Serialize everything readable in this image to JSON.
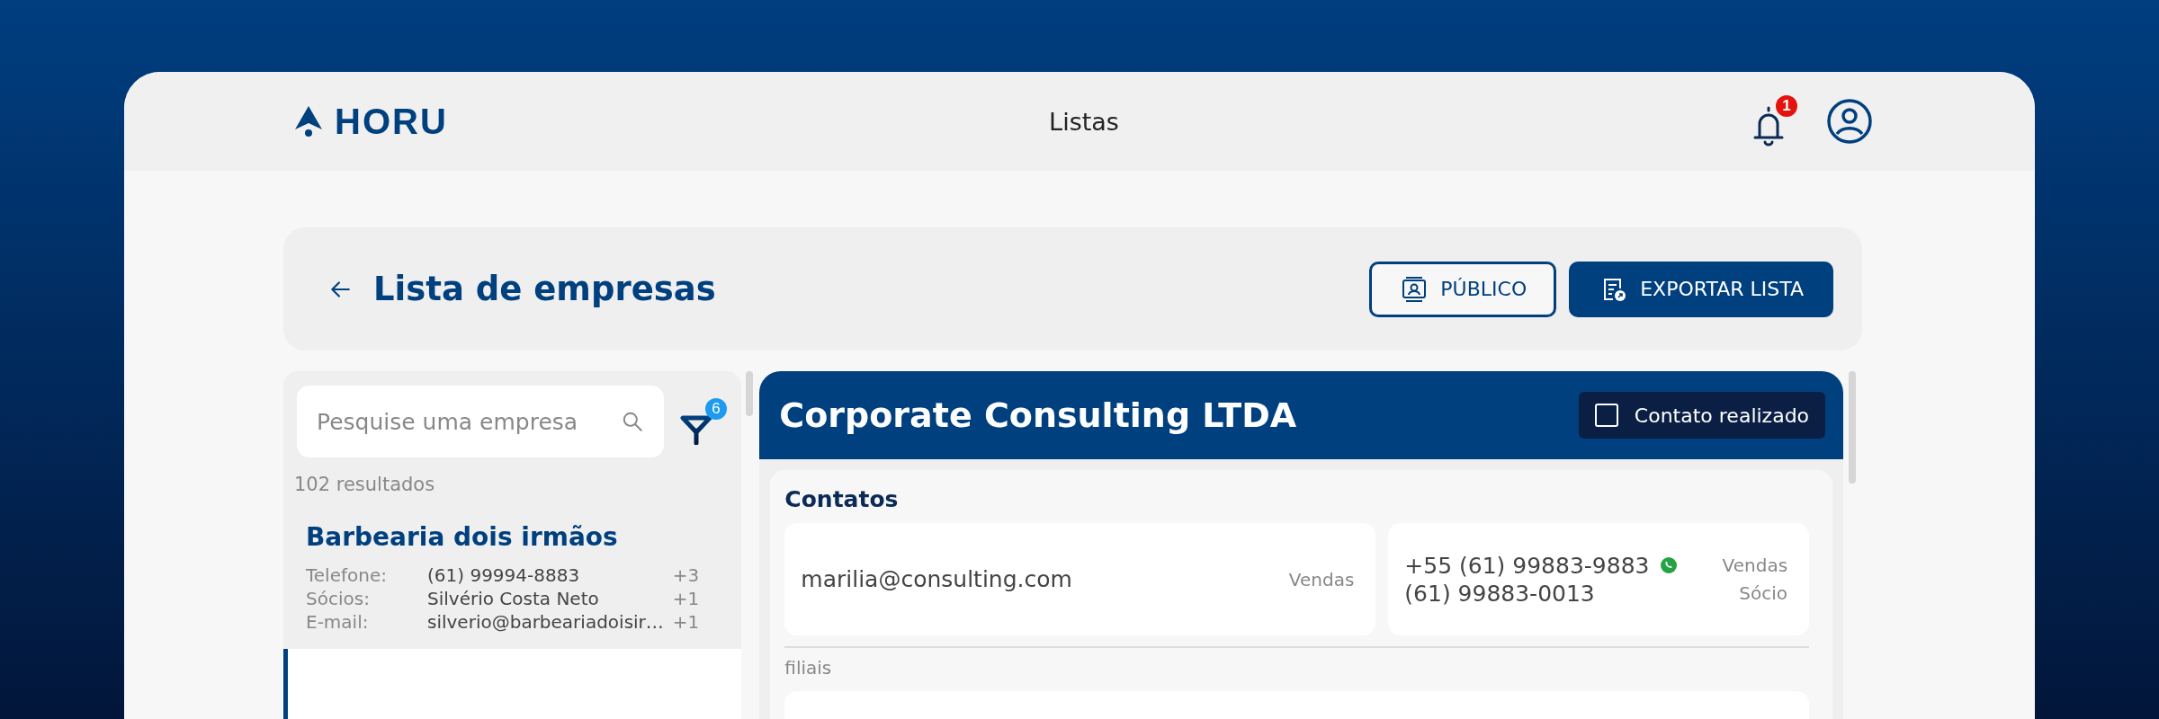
{
  "header": {
    "logo": "HORU",
    "title": "Listas",
    "notification_count": "1"
  },
  "page": {
    "title": "Lista de empresas",
    "buttons": [
      {
        "label": "PÚBLICO",
        "kind": "outline"
      },
      {
        "label": "EXPORTAR LISTA",
        "kind": "filled"
      }
    ]
  },
  "sidebar": {
    "search": {
      "placeholder": "Pesquise uma empresa"
    },
    "filter_count": "6",
    "results": "102 resultados",
    "companies": [
      {
        "name": "Barbearia dois irmãos",
        "fields": [
          {
            "label": "Telefone:",
            "value": "(61) 99994-8883",
            "extra": "+3"
          },
          {
            "label": "Sócios:",
            "value": "Silvério Costa Neto",
            "extra": "+1"
          },
          {
            "label": "E-mail:",
            "value": "silverio@barbeariadoisir…",
            "extra": "+1"
          }
        ]
      }
    ]
  },
  "detail": {
    "title": "Corporate Consulting LTDA",
    "contact_done": {
      "label": "Contato realizado",
      "checked": false
    },
    "contacts_title": "Contatos",
    "contacts": [
      {
        "lines": [
          {
            "value": "marilia@consulting.com",
            "role": "Vendas",
            "whatsapp": false
          }
        ]
      },
      {
        "lines": [
          {
            "value": "+55 (61) 99883-9883",
            "role": "Vendas",
            "whatsapp": true
          },
          {
            "value": "(61) 99883-0013",
            "role": "Sócio",
            "whatsapp": false
          }
        ]
      }
    ],
    "branches_label": "filiais"
  }
}
